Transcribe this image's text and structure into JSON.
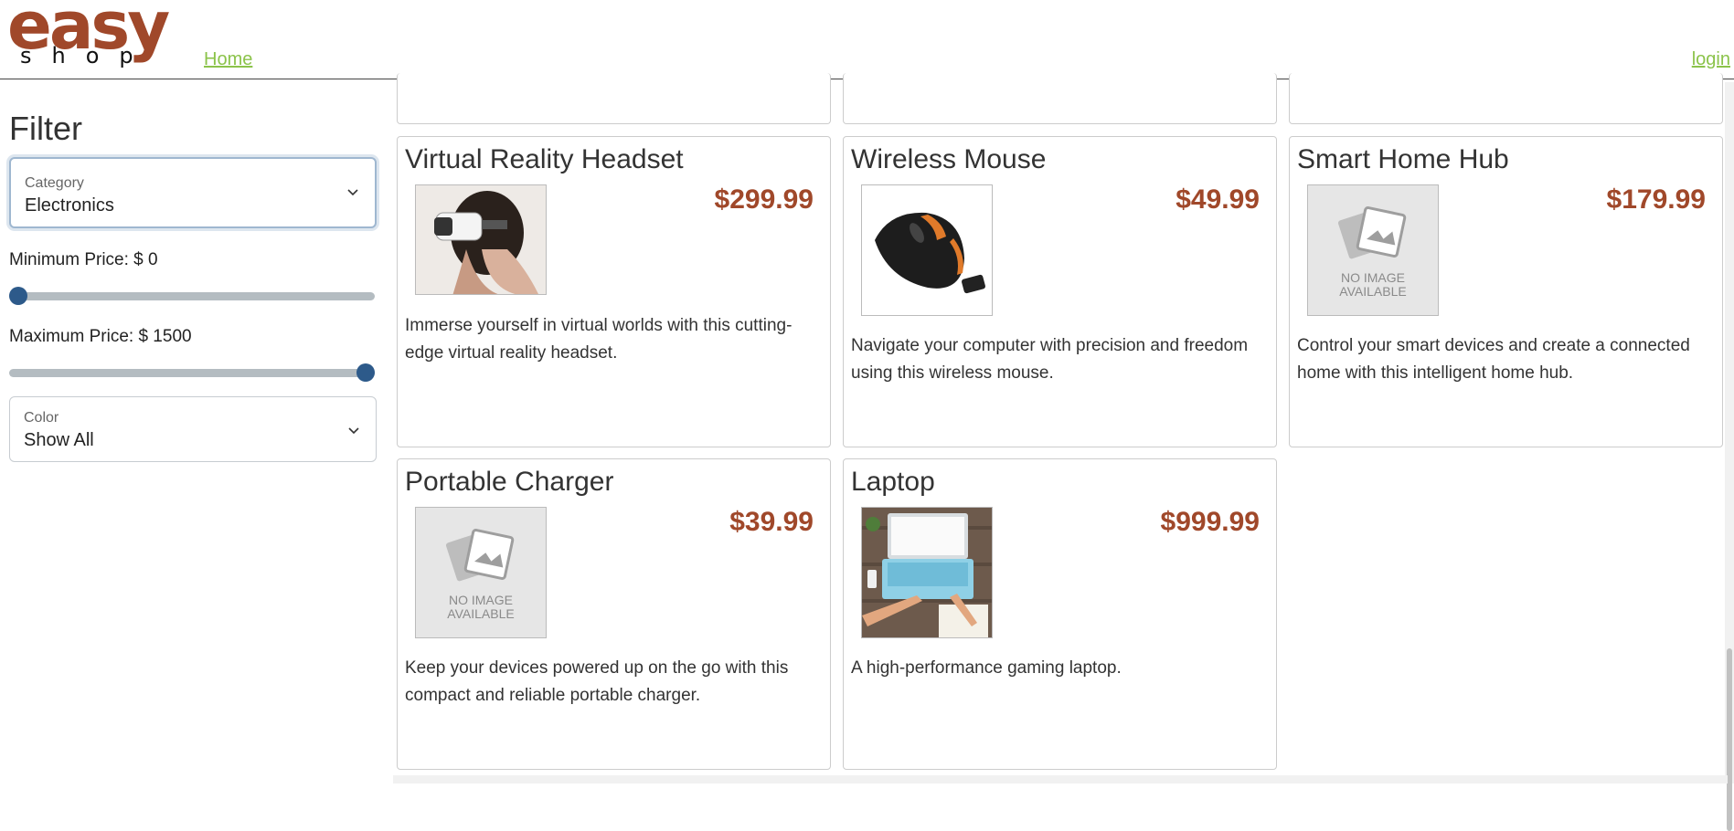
{
  "header": {
    "logo_top": "easy",
    "logo_bottom": "shop",
    "home_link": "Home",
    "login_link": "login"
  },
  "filter": {
    "title": "Filter",
    "category": {
      "label": "Category",
      "value": "Electronics"
    },
    "min_price": {
      "label": "Minimum Price: $ 0",
      "value": 0,
      "min": 0,
      "max": 1500
    },
    "max_price": {
      "label": "Maximum Price: $ 1500",
      "value": 1500,
      "min": 0,
      "max": 1500
    },
    "color": {
      "label": "Color",
      "value": "Show All"
    }
  },
  "products": [
    {
      "name": "Virtual Reality Headset",
      "price": "$299.99",
      "description": "Immerse yourself in virtual worlds with this cutting-edge virtual reality headset.",
      "image": "vr-headset-photo"
    },
    {
      "name": "Wireless Mouse",
      "price": "$49.99",
      "description": "Navigate your computer with precision and freedom using this wireless mouse.",
      "image": "wireless-mouse-photo"
    },
    {
      "name": "Smart Home Hub",
      "price": "$179.99",
      "description": "Control your smart devices and create a connected home with this intelligent home hub.",
      "image": "no-image-placeholder"
    },
    {
      "name": "Portable Charger",
      "price": "$39.99",
      "description": "Keep your devices powered up on the go with this compact and reliable portable charger.",
      "image": "no-image-placeholder"
    },
    {
      "name": "Laptop",
      "price": "$999.99",
      "description": "A high-performance gaming laptop.",
      "image": "laptop-photo"
    }
  ],
  "placeholder_text": {
    "line1": "NO IMAGE",
    "line2": "AVAILABLE"
  },
  "colors": {
    "brand": "#a0482a",
    "link": "#8bc34a",
    "slider_thumb": "#2d5a8a"
  }
}
